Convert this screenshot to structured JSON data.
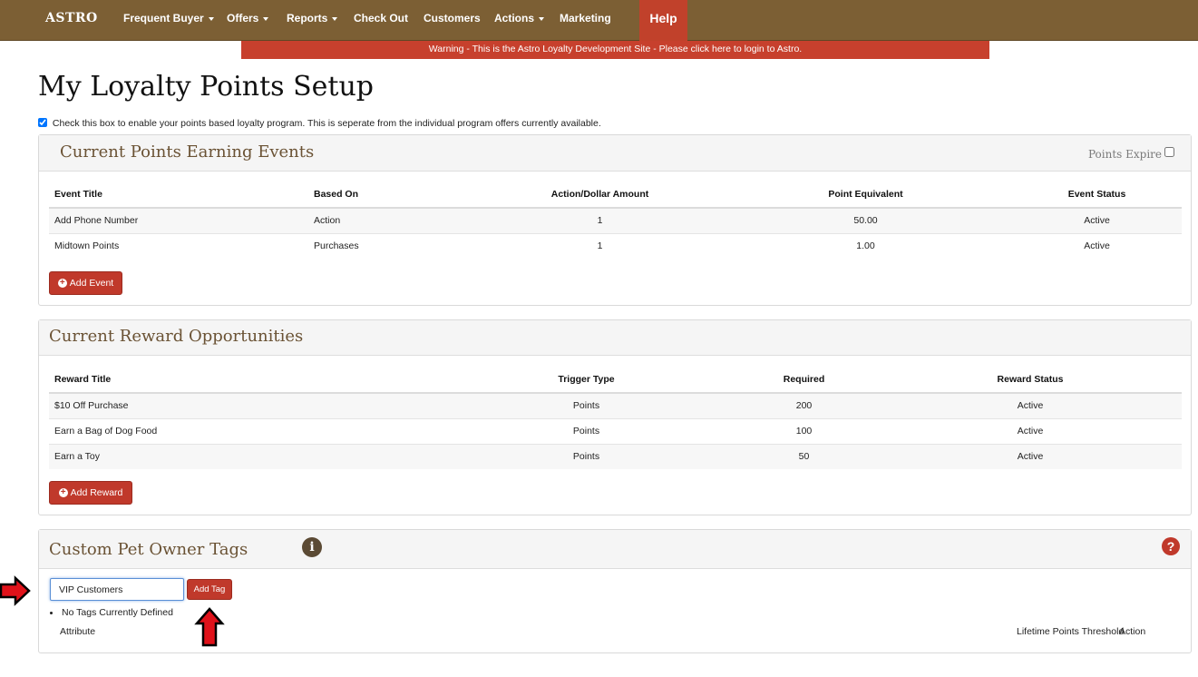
{
  "navbar": {
    "brand": "ASTRO",
    "items": [
      {
        "label": "Frequent Buyer",
        "dropdown": true
      },
      {
        "label": "Offers",
        "dropdown": true
      },
      {
        "label": "Reports",
        "dropdown": true
      },
      {
        "label": "Check Out",
        "dropdown": false
      },
      {
        "label": "Customers",
        "dropdown": false
      },
      {
        "label": "Actions",
        "dropdown": true
      },
      {
        "label": "Marketing",
        "dropdown": false
      }
    ],
    "help": "Help"
  },
  "warning": "Warning - This is the Astro Loyalty Development Site - Please click here to login to Astro.",
  "page_title": "My Loyalty Points Setup",
  "enable_program": {
    "checked": true,
    "label": "Check this box to enable your points based loyalty program. This is seperate from the individual program offers currently available."
  },
  "earning_events": {
    "title": "Current Points Earning Events",
    "points_expire_label": "Points Expire",
    "points_expire_checked": false,
    "columns": [
      "Event Title",
      "Based On",
      "Action/Dollar Amount",
      "Point Equivalent",
      "Event Status"
    ],
    "rows": [
      [
        "Add Phone Number",
        "Action",
        "1",
        "50.00",
        "Active"
      ],
      [
        "Midtown Points",
        "Purchases",
        "1",
        "1.00",
        "Active"
      ]
    ],
    "add_button": "Add Event"
  },
  "rewards": {
    "title": "Current Reward Opportunities",
    "columns": [
      "Reward Title",
      "Trigger Type",
      "Required",
      "Reward Status"
    ],
    "rows": [
      [
        "$10 Off Purchase",
        "Points",
        "200",
        "Active"
      ],
      [
        "Earn a Bag of Dog Food",
        "Points",
        "100",
        "Active"
      ],
      [
        "Earn a Toy",
        "Points",
        "50",
        "Active"
      ]
    ],
    "add_button": "Add Reward"
  },
  "tags": {
    "title": "Custom Pet Owner Tags",
    "input_value": "VIP Customers",
    "add_button": "Add Tag",
    "empty_message": "No Tags Currently Defined",
    "columns": [
      "Attribute",
      "Lifetime Points Threshold",
      "Action"
    ]
  },
  "colors": {
    "navbar": "#7c5f34",
    "accent_red": "#c0392b",
    "link_brown": "#6b5436"
  },
  "icons": [
    "caret-down-icon",
    "plus-circle-icon",
    "info-circle-icon",
    "question-circle-icon",
    "red-arrow-right-icon",
    "red-arrow-up-icon"
  ]
}
